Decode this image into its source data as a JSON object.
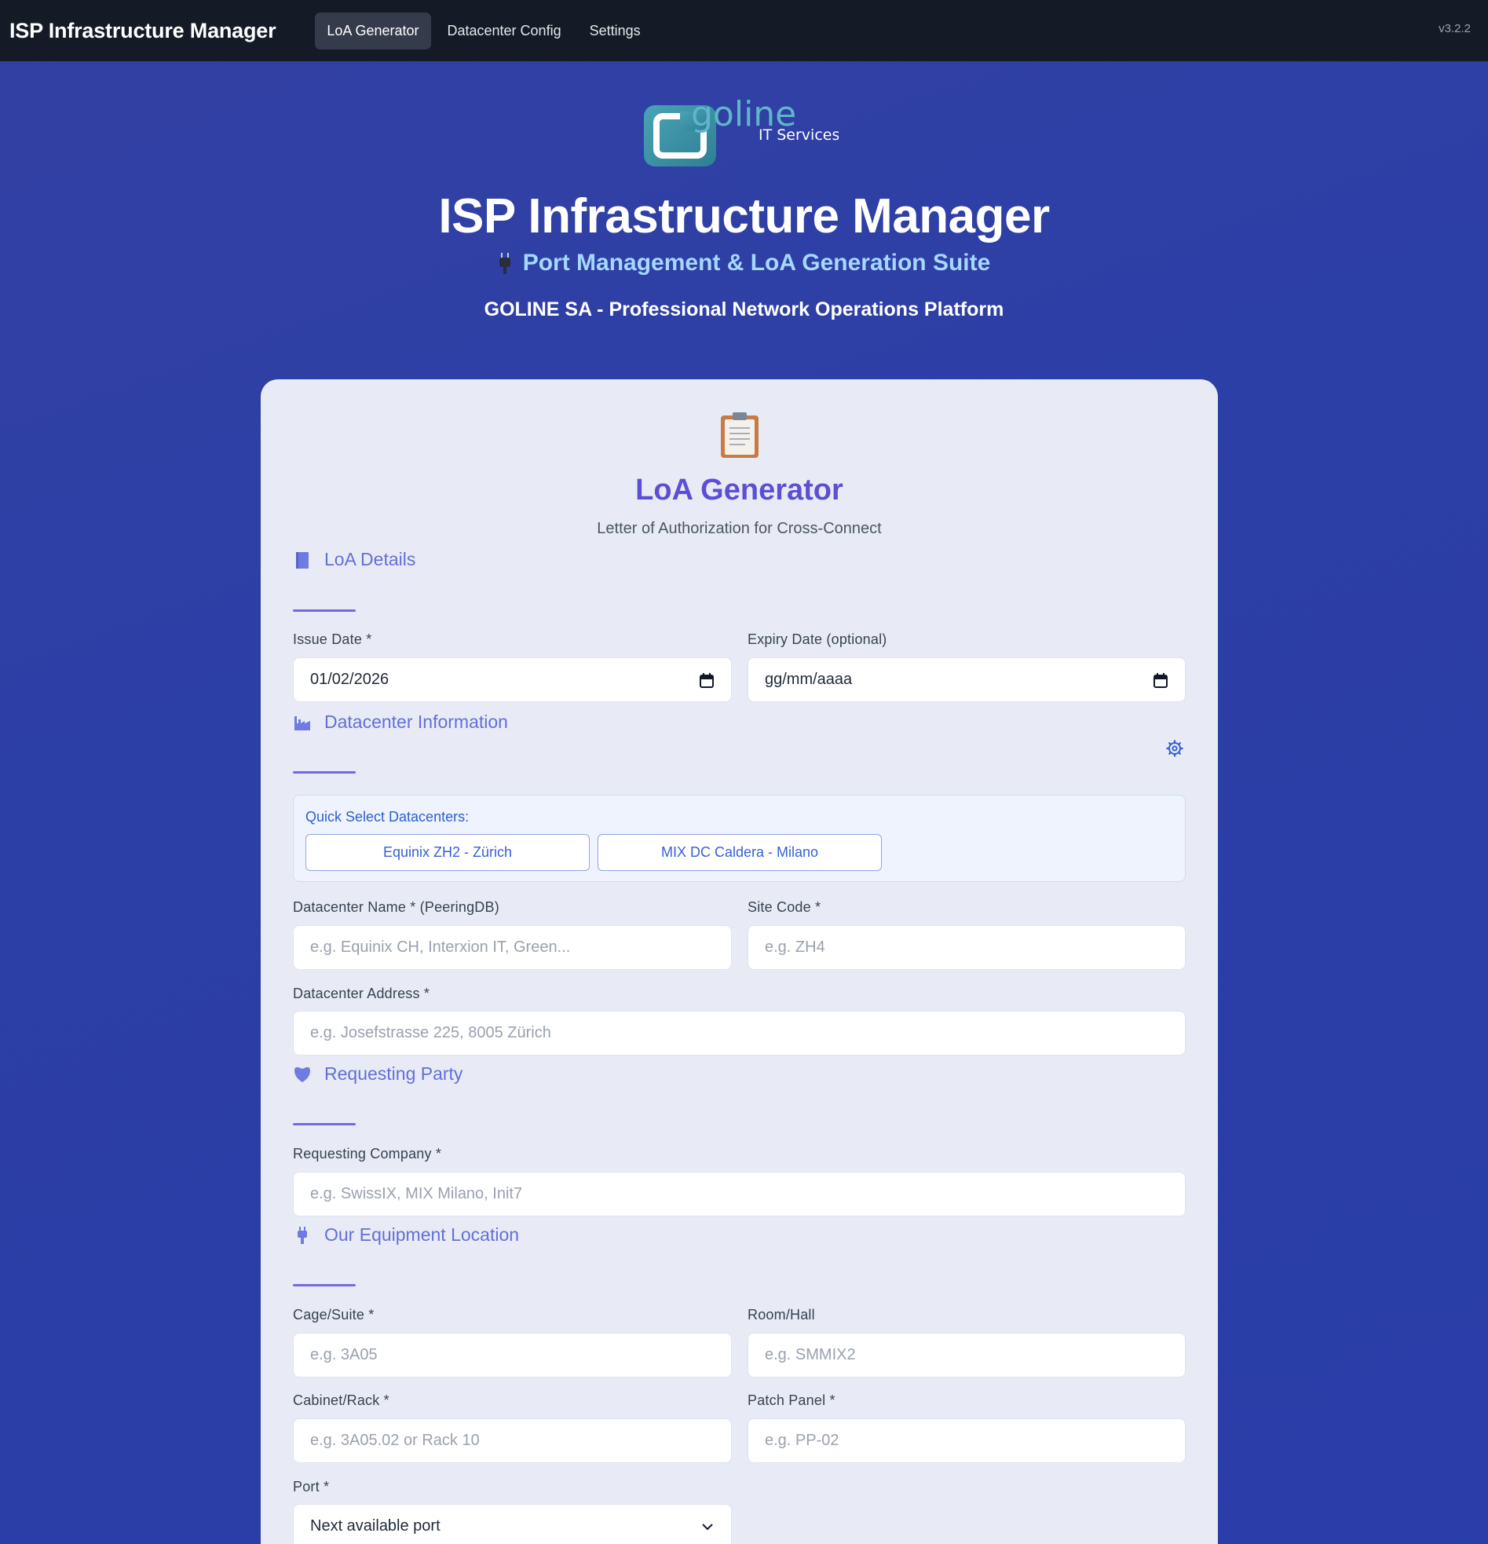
{
  "navbar": {
    "brand": "ISP Infrastructure Manager",
    "tabs": [
      {
        "label": "LoA Generator",
        "active": true
      },
      {
        "label": "Datacenter Config",
        "active": false
      },
      {
        "label": "Settings",
        "active": false
      }
    ],
    "version": "v3.2.2"
  },
  "hero": {
    "logo_text": "goline",
    "logo_tagline": "IT Services",
    "title": "ISP Infrastructure Manager",
    "subtitle": "Port Management & LoA Generation Suite",
    "company": "GOLINE SA - Professional Network Operations Platform"
  },
  "card": {
    "icon": "clipboard-icon",
    "title": "LoA Generator",
    "subtitle": "Letter of Authorization for Cross-Connect"
  },
  "sections": {
    "loa_details": {
      "title": "LoA Details",
      "icon": "book-icon",
      "issue_date_label": "Issue Date *",
      "issue_date_value": "01/02/2026",
      "expiry_date_label": "Expiry Date (optional)",
      "expiry_date_value": "gg/mm/aaaa"
    },
    "datacenter": {
      "title": "Datacenter Information",
      "icon": "factory-icon",
      "quick_label": "Quick Select Datacenters:",
      "quick_buttons": [
        "Equinix ZH2 - Zürich",
        "MIX DC Caldera - Milano"
      ],
      "name_label": "Datacenter Name * (PeeringDB)",
      "name_placeholder": "e.g. Equinix CH, Interxion IT, Green...",
      "site_code_label": "Site Code *",
      "site_code_placeholder": "e.g. ZH4",
      "address_label": "Datacenter Address *",
      "address_placeholder": "e.g. Josefstrasse 225, 8005 Zürich"
    },
    "requesting_party": {
      "title": "Requesting Party",
      "icon": "heart-icon",
      "company_label": "Requesting Company *",
      "company_placeholder": "e.g. SwissIX, MIX Milano, Init7"
    },
    "equipment": {
      "title": "Our Equipment Location",
      "icon": "plug-icon",
      "cage_label": "Cage/Suite *",
      "cage_placeholder": "e.g. 3A05",
      "room_label": "Room/Hall",
      "room_placeholder": "e.g. SMMIX2",
      "cabinet_label": "Cabinet/Rack *",
      "cabinet_placeholder": "e.g. 3A05.02 or Rack 10",
      "patch_label": "Patch Panel *",
      "patch_placeholder": "e.g. PP-02",
      "port_label": "Port *",
      "port_value": "Next available port"
    }
  },
  "colors": {
    "navbar_bg": "#151a27",
    "page_bg": "#2c3fa6",
    "accent": "#5b4fd6",
    "section_title": "#6270d8",
    "subtitle": "#a5d8ff"
  }
}
